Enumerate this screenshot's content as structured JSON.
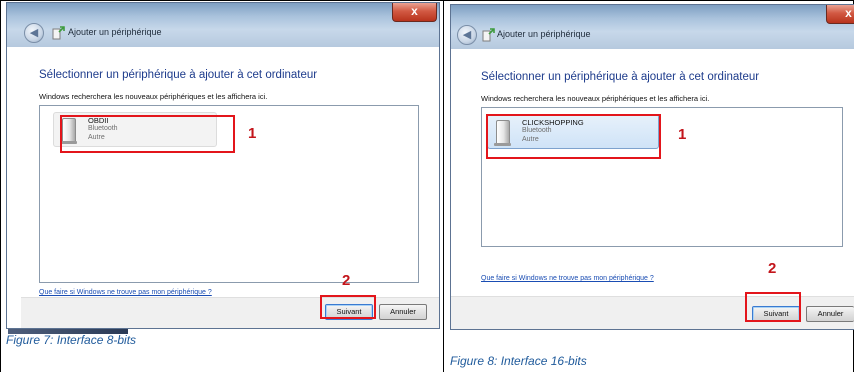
{
  "figures": [
    {
      "window": {
        "close_label": "x",
        "back_icon": "back-arrow-icon",
        "wizard_icon": "add-device-icon",
        "title": "Ajouter un périphérique"
      },
      "heading": "Sélectionner un périphérique à ajouter à cet ordinateur",
      "subtext": "Windows recherchera les nouveaux périphériques et les affichera ici.",
      "device": {
        "name": "OBDII",
        "type": "Bluetooth",
        "category": "Autre"
      },
      "help_link": "Que faire si Windows ne trouve pas mon périphérique ?",
      "next_button": "Suivant",
      "cancel_button": "Annuler",
      "marker_1": "1",
      "marker_2": "2",
      "caption": "Figure 7: Interface 8-bits"
    },
    {
      "window": {
        "close_label": "x",
        "back_icon": "back-arrow-icon",
        "wizard_icon": "add-device-icon",
        "title": "Ajouter un périphérique"
      },
      "heading": "Sélectionner un périphérique à ajouter à cet ordinateur",
      "subtext": "Windows recherchera les nouveaux périphériques et les affichera ici.",
      "device": {
        "name": "CLICKSHOPPING",
        "type": "Bluetooth",
        "category": "Autre"
      },
      "help_link": "Que faire si Windows ne trouve pas mon périphérique ?",
      "next_button": "Suivant",
      "cancel_button": "Annuler",
      "marker_1": "1",
      "marker_2": "2",
      "caption": "Figure 8: Interface 16-bits"
    }
  ],
  "colors": {
    "heading": "#1e3c8c",
    "link": "#1a4db3",
    "highlight": "#e3151b",
    "caption": "#1f5a9b"
  }
}
